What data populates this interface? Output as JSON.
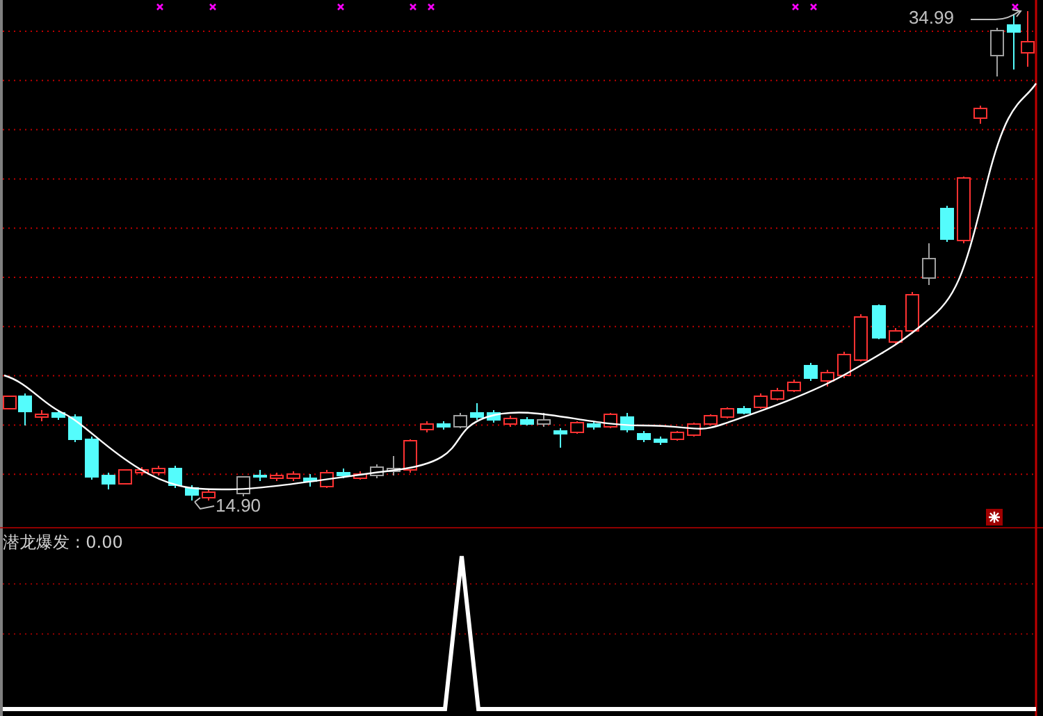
{
  "main_panel": {
    "high_label": "34.99",
    "low_label": "14.90"
  },
  "indicator_panel": {
    "title": "潜龙爆发 : 0.00"
  }
}
